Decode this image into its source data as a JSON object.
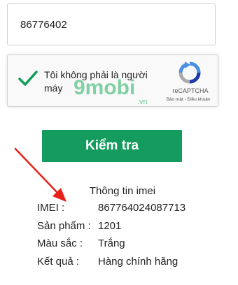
{
  "imei_input": {
    "value": "86776402"
  },
  "recaptcha": {
    "label": "Tôi không phải là người máy",
    "brand": "reCAPTCHA",
    "terms": "Bảo mật - Điều khoản",
    "watermark_main": "9mobi",
    "watermark_sub": ".vn",
    "check_color": "#0f9d58"
  },
  "check_button": {
    "label": "Kiểm tra",
    "color": "#149b5e"
  },
  "result": {
    "title": "Thông tin imei",
    "rows": [
      {
        "label": "IMEI :",
        "value": "867764024087713"
      },
      {
        "label": "Sản phẩm :",
        "value": "1201"
      },
      {
        "label": "Màu sắc :",
        "value": "Trắng"
      },
      {
        "label": "Kết quả :",
        "value": "Hàng chính hãng"
      }
    ]
  },
  "annotation": {
    "arrow_color": "#e8201a"
  }
}
